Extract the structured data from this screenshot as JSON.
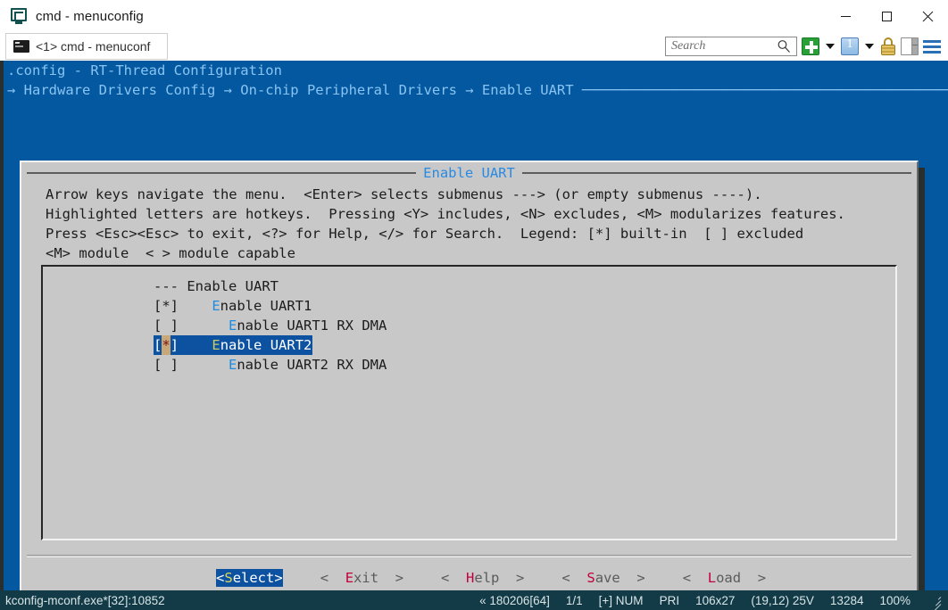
{
  "window": {
    "title": "cmd - menuconfig",
    "icon": "console-app-icon",
    "minimize_label": "─",
    "maximize_label": "☐",
    "close_label": "✕"
  },
  "tabstrip": {
    "tab_label": "<1> cmd - menuconf",
    "tab_icon": "console-icon"
  },
  "toolbar": {
    "search_placeholder": "Search",
    "search_value": "",
    "icons": [
      "search-icon",
      "new-tab-plus-icon",
      "new-tab-dropdown-icon",
      "window-one-icon",
      "window-dropdown-icon",
      "lock-icon",
      "split-pane-icon",
      "menu-hamburger-icon"
    ]
  },
  "console": {
    "title_line": ".config - RT-Thread Configuration",
    "breadcrumb": "→ Hardware Drivers Config → On-chip Peripheral Drivers → Enable UART",
    "breadcrumb_tail": " ───────────────────────────────────────────────────────"
  },
  "dialog": {
    "title": "Enable UART",
    "help_lines": [
      "Arrow keys navigate the menu.  <Enter> selects submenus ---> (or empty submenus ----).",
      "Highlighted letters are hotkeys.  Pressing <Y> includes, <N> excludes, <M> modularizes features.",
      "Press <Esc><Esc> to exit, <?> for Help, </> for Search.  Legend: [*] built-in  [ ] excluded",
      "<M> module  < > module capable"
    ],
    "rows": [
      {
        "marker": "---",
        "indent": "",
        "hotkey": "",
        "label": "Enable UART",
        "selected": false,
        "type": "section"
      },
      {
        "marker": "[*]",
        "indent": "   ",
        "hotkey": "E",
        "label": "nable UART1",
        "selected": false,
        "type": "bool"
      },
      {
        "marker": "[ ]",
        "indent": "     ",
        "hotkey": "E",
        "label": "nable UART1 RX DMA",
        "selected": false,
        "type": "bool"
      },
      {
        "marker": "[*]",
        "indent": "   ",
        "hotkey": "E",
        "label": "nable UART2",
        "selected": true,
        "type": "bool"
      },
      {
        "marker": "[ ]",
        "indent": "     ",
        "hotkey": "E",
        "label": "nable UART2 RX DMA",
        "selected": false,
        "type": "bool"
      }
    ],
    "buttons": [
      {
        "pre": "<",
        "hk": "S",
        "post": "elect>",
        "selected": true
      },
      {
        "pre": "<  ",
        "hk": "E",
        "post": "xit  >",
        "selected": false
      },
      {
        "pre": "<  ",
        "hk": "H",
        "post": "elp  >",
        "selected": false
      },
      {
        "pre": "<  ",
        "hk": "S",
        "post": "ave  >",
        "selected": false
      },
      {
        "pre": "<  ",
        "hk": "L",
        "post": "oad  >",
        "selected": false
      }
    ]
  },
  "statusbar": {
    "left": "kconfig-mconf.exe*[32]:10852",
    "items": [
      "« 180206[64]",
      "1/1",
      "[+] NUM",
      "PRI",
      "106x27",
      "(19,12) 25V",
      "13284",
      "100%"
    ]
  },
  "colors": {
    "console_blue": "#0458a0",
    "console_text": "#89c4f2",
    "dialog_bg": "#c8c8c8",
    "dialog_title": "#2b8ae0",
    "selection_blue": "#0c52a0",
    "hotkey_blue": "#1f8ce0",
    "hotkey_red": "#c2003c",
    "cursor_tan": "#c8a878",
    "statusbar_bg": "#123b47",
    "shadow_dark": "#27302e"
  }
}
